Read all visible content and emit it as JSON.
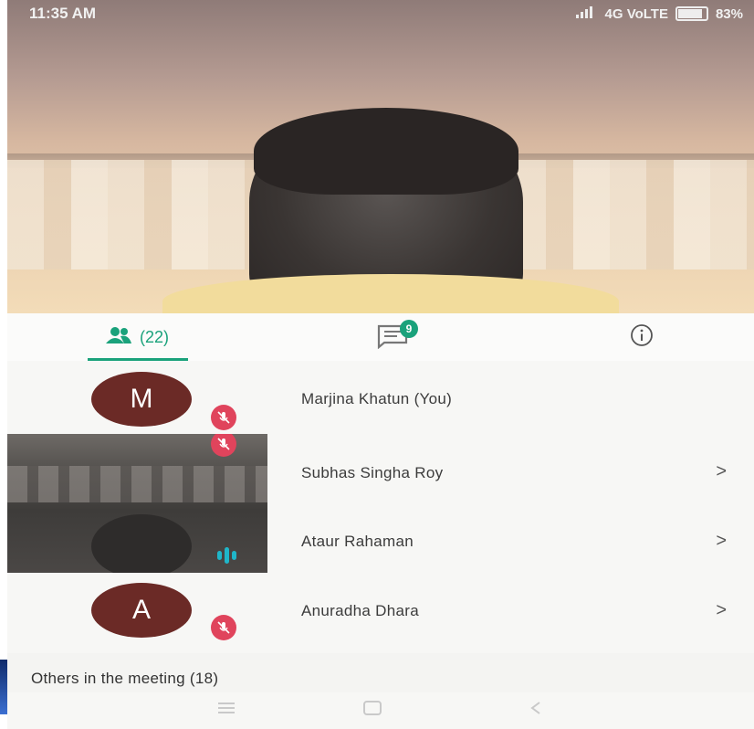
{
  "status_bar": {
    "time": "11:35 AM",
    "network": "4G VoLTE",
    "battery": "83%"
  },
  "tabs": {
    "people_count": "(22)",
    "chat_badge": "9"
  },
  "participants": [
    {
      "initial": "M",
      "name": "Marjina Khatun (You)",
      "chevron": "",
      "muted": true,
      "avatar_color": "#6b2a26"
    },
    {
      "initial": "",
      "name": "Subhas Singha Roy",
      "chevron": ">",
      "muted": true
    },
    {
      "initial": "",
      "name": "Ataur Rahaman",
      "chevron": ">",
      "muted": false,
      "speaking": true
    },
    {
      "initial": "A",
      "name": "Anuradha Dhara",
      "chevron": ">",
      "muted": true,
      "avatar_color": "#6b2a26"
    }
  ],
  "others_label": "Others in the meeting (18)",
  "colors": {
    "accent": "#1aa27b",
    "mute": "#e0445c",
    "speaking": "#1fb6c9"
  },
  "icons": [
    "people-icon",
    "chat-icon",
    "info-icon",
    "mic-off-icon",
    "speaking-icon",
    "home-icon",
    "recents-icon",
    "back-icon"
  ]
}
